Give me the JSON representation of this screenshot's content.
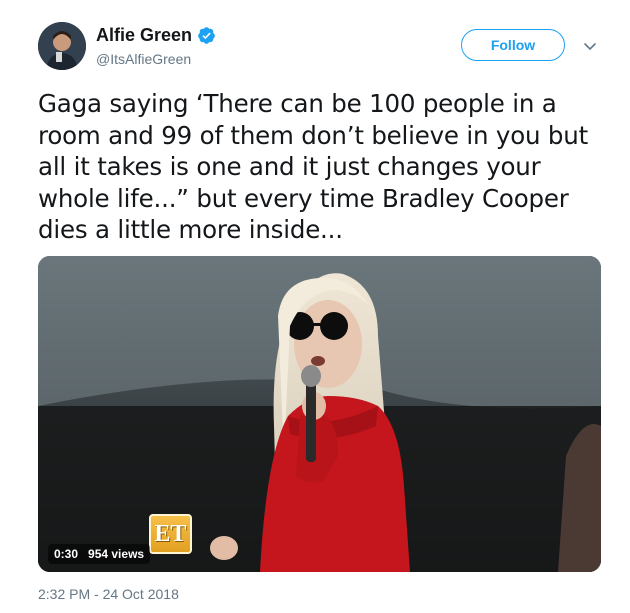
{
  "user": {
    "display_name": "Alfie Green",
    "handle": "@ItsAlfieGreen",
    "verified": true
  },
  "actions": {
    "follow_label": "Follow"
  },
  "tweet": {
    "lines": [
      "Gaga saying ‘There can be 100 people in a",
      "room and 99 of them don’t believe in you but",
      "all it takes is one and it just changes your",
      "whole life...” but every time Bradley Cooper",
      "dies a little more inside..."
    ],
    "timestamp": "2:32 PM - 24 Oct 2018"
  },
  "video": {
    "duration": "0:30",
    "views": "954 views",
    "watermark_logo_text": "ET"
  },
  "colors": {
    "accent": "#1da1f2",
    "secondary_text": "#657786",
    "primary_text": "#14171a"
  },
  "icons": {
    "verified": "verified-badge-icon",
    "caret": "chevron-down-icon"
  }
}
